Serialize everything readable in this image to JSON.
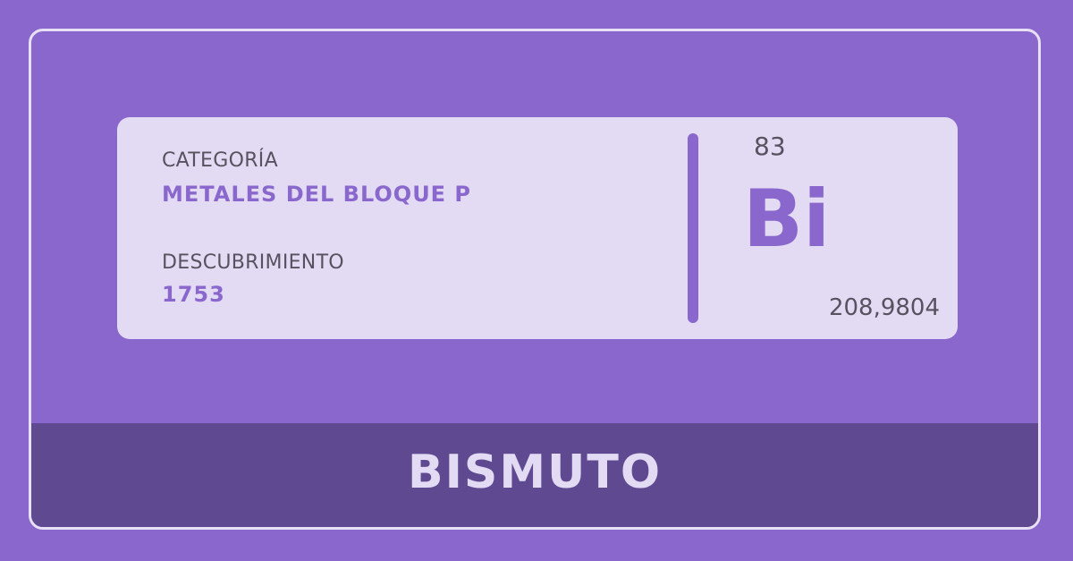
{
  "element": {
    "category_label": "CATEGORÍA",
    "category_value": "METALES DEL BLOQUE P",
    "discovery_label": "DESCUBRIMIENTO",
    "discovery_value": "1753",
    "atomic_number": "83",
    "symbol": "Bi",
    "atomic_mass": "208,9804",
    "name": "BISMUTO"
  },
  "colors": {
    "background": "#8a67cc",
    "card": "#e3dbf4",
    "footer": "#5f4a92",
    "text_dark": "#57525f"
  }
}
